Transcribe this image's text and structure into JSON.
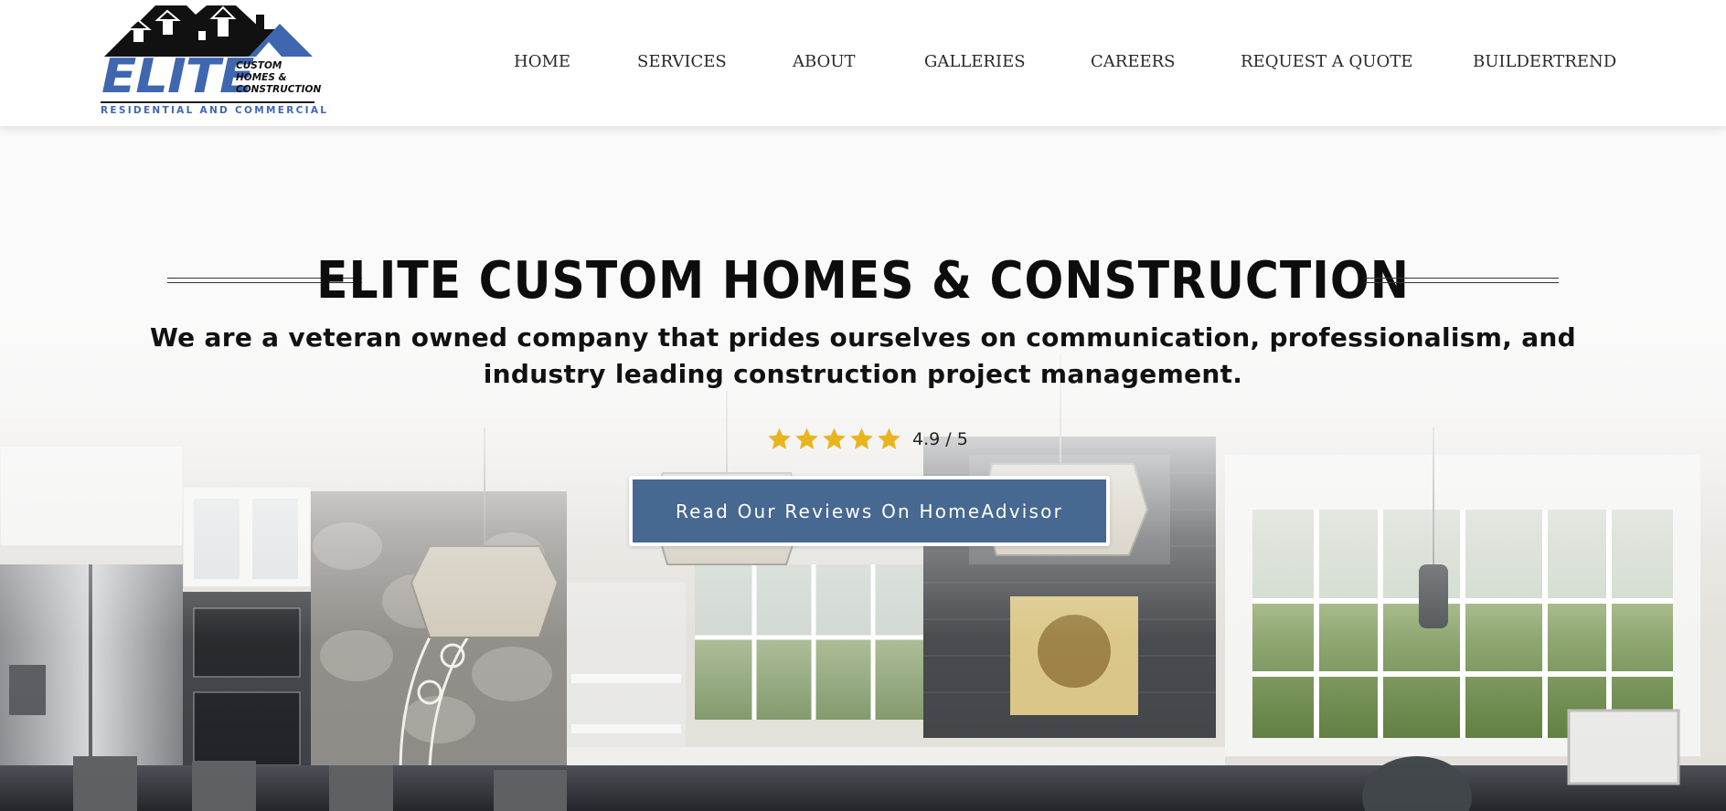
{
  "brand": {
    "logo_name": "ELITE",
    "logo_side_text": "CUSTOM HOMES & CONSTRUCTION",
    "logo_tagline": "RESIDENTIAL AND COMMERCIAL",
    "logo_blue": "#3f67b0"
  },
  "nav": {
    "items": [
      {
        "label": "HOME"
      },
      {
        "label": "SERVICES"
      },
      {
        "label": "ABOUT"
      },
      {
        "label": "GALLERIES"
      },
      {
        "label": "CAREERS"
      },
      {
        "label": "REQUEST A QUOTE"
      },
      {
        "label": "BUILDERTREND"
      }
    ]
  },
  "hero": {
    "title": "ELITE CUSTOM HOMES & CONSTRUCTION",
    "subtitle": "We are a veteran owned company that prides ourselves on communication, professionalism, and industry leading construction project management.",
    "rating": {
      "stars": 5,
      "value_text": "4.9 / 5",
      "star_color": "#e8b420"
    },
    "cta_label": "Read Our Reviews On HomeAdvisor",
    "cta_color": "#466891",
    "background_image": "kitchen-interior-photo"
  }
}
